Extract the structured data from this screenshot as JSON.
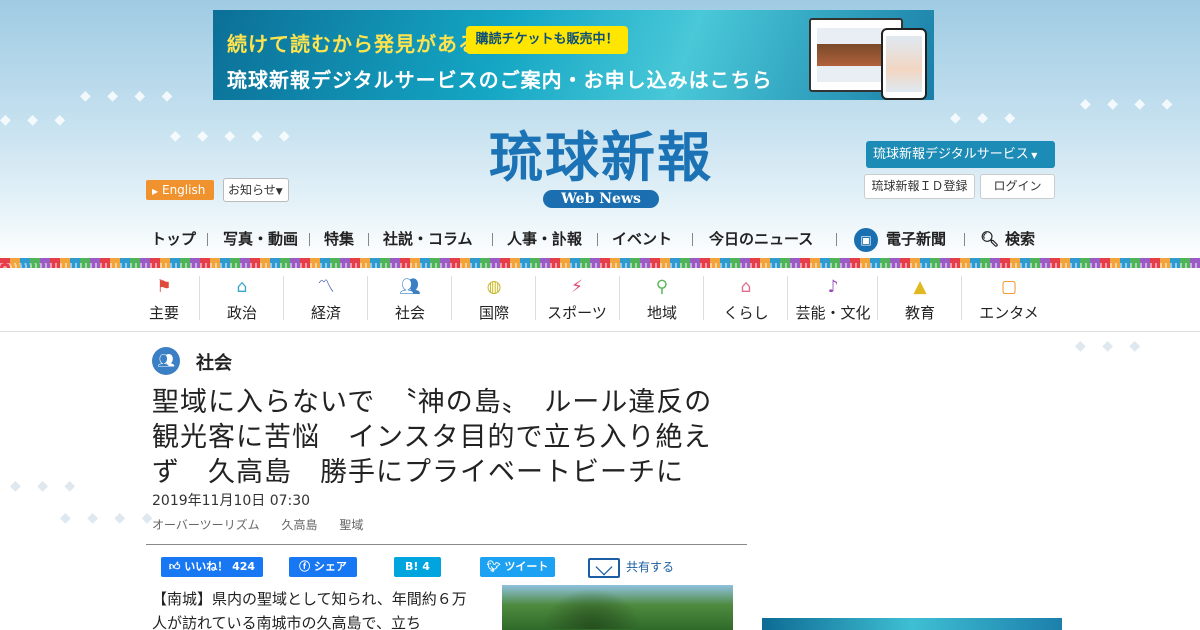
{
  "banner": {
    "line1": "続けて読むから発見がある",
    "badge": "購読チケットも販売中！",
    "line2": "琉球新報デジタルサービスのご案内・お申し込みはこちら"
  },
  "logo": {
    "main": "琉球新報",
    "sub": "Web News"
  },
  "header": {
    "english": "English",
    "notice": "お知らせ",
    "digital_service": "琉球新報デジタルサービス",
    "id_register": "琉球新報ＩＤ登録",
    "login": "ログイン"
  },
  "main_nav": [
    "トップ",
    "写真・動画",
    "特集",
    "社説・コラム",
    "人事・訃報",
    "イベント",
    "今日のニュース",
    "電子新聞",
    "検索"
  ],
  "categories": [
    {
      "label": "主要",
      "icon": "flag-icon",
      "color": "#e04a3c"
    },
    {
      "label": "政治",
      "icon": "government-icon",
      "color": "#3aa8c8"
    },
    {
      "label": "経済",
      "icon": "chart-icon",
      "color": "#3a58a8"
    },
    {
      "label": "社会",
      "icon": "people-icon",
      "color": "#3b7fc4"
    },
    {
      "label": "国際",
      "icon": "globe-icon",
      "color": "#c8b820"
    },
    {
      "label": "スポーツ",
      "icon": "runner-icon",
      "color": "#e05070"
    },
    {
      "label": "地域",
      "icon": "pin-icon",
      "color": "#5cb85c"
    },
    {
      "label": "くらし",
      "icon": "home-icon",
      "color": "#e07090"
    },
    {
      "label": "芸能・文化",
      "icon": "sanshin-icon",
      "color": "#9a4cb8"
    },
    {
      "label": "教育",
      "icon": "graduation-icon",
      "color": "#e0b820"
    },
    {
      "label": "エンタメ",
      "icon": "tv-icon",
      "color": "#f09020"
    }
  ],
  "article": {
    "section": "社会",
    "headline": "聖域に入らないで　〝神の島〟　ルール違反の観光客に苦悩　インスタ目的で立ち入り絶えず　久高島　勝手にプライベートビーチに",
    "date": "2019年11月10日 07:30",
    "tags": [
      "オーバーツーリズム",
      "久高島",
      "聖域"
    ],
    "body": "【南城】県内の聖域として知られ、年間約６万人が訪れている南城市の久高島で、立ち"
  },
  "share": {
    "like": "いいね！ 424",
    "fb": "シェア",
    "hatena": "B! 4",
    "tweet": "ツイート",
    "mail": "共有する"
  }
}
